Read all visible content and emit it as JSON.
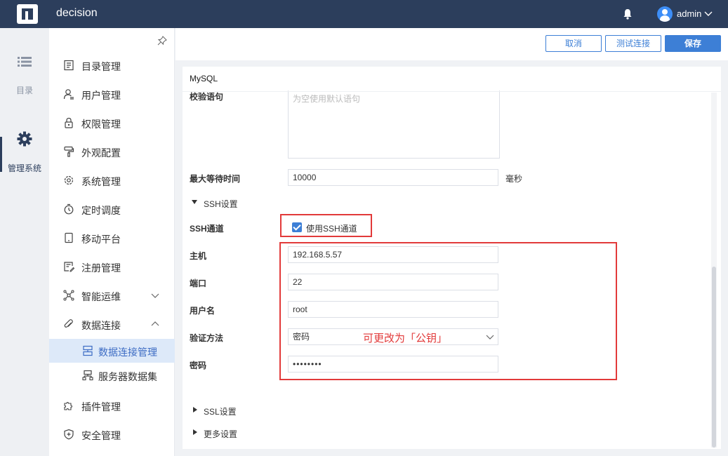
{
  "app": {
    "title": "decision",
    "username": "admin"
  },
  "rail": {
    "items": [
      {
        "label": "目录",
        "icon": "list-icon"
      },
      {
        "label": "管理系统",
        "icon": "gear-icon"
      }
    ]
  },
  "menu": {
    "items": [
      {
        "label": "目录管理",
        "icon": "catalog-icon"
      },
      {
        "label": "用户管理",
        "icon": "user-icon"
      },
      {
        "label": "权限管理",
        "icon": "lock-icon"
      },
      {
        "label": "外观配置",
        "icon": "paint-roller-icon"
      },
      {
        "label": "系统管理",
        "icon": "settings-icon"
      },
      {
        "label": "定时调度",
        "icon": "timer-icon"
      },
      {
        "label": "移动平台",
        "icon": "tablet-icon"
      },
      {
        "label": "注册管理",
        "icon": "register-icon"
      },
      {
        "label": "智能运维",
        "icon": "network-icon"
      },
      {
        "label": "数据连接",
        "icon": "paperclip-icon"
      },
      {
        "label": "插件管理",
        "icon": "puzzle-icon"
      },
      {
        "label": "安全管理",
        "icon": "shield-icon"
      }
    ],
    "subitems": [
      {
        "label": "数据连接管理",
        "icon": "data-connection-icon",
        "active": true
      },
      {
        "label": "服务器数据集",
        "icon": "server-dataset-icon",
        "active": false
      }
    ]
  },
  "actions": {
    "cancel": "取消",
    "test": "测试连接",
    "save": "保存"
  },
  "panel": {
    "title": "MySQL",
    "validation_label": "校验语句",
    "validation_placeholder": "为空使用默认语句",
    "max_wait_label": "最大等待时间",
    "max_wait_value": "10000",
    "max_wait_unit": "毫秒",
    "ssh_section": "SSH设置",
    "ssh_channel_label": "SSH通道",
    "ssh_checkbox_label": "使用SSH通道",
    "host_label": "主机",
    "host_value": "192.168.5.57",
    "port_label": "端口",
    "port_value": "22",
    "user_label": "用户名",
    "user_value": "root",
    "auth_label": "验证方法",
    "auth_value": "密码",
    "password_label": "密码",
    "password_value": "••••••••",
    "annotation": "可更改为「公钥」",
    "ssl_section": "SSL设置",
    "more_section": "更多设置"
  },
  "colors": {
    "topbar": "#2c3e5c",
    "accent": "#3d7fd6",
    "highlight_red": "#e23a3a",
    "active_bg": "#dde9f9"
  }
}
